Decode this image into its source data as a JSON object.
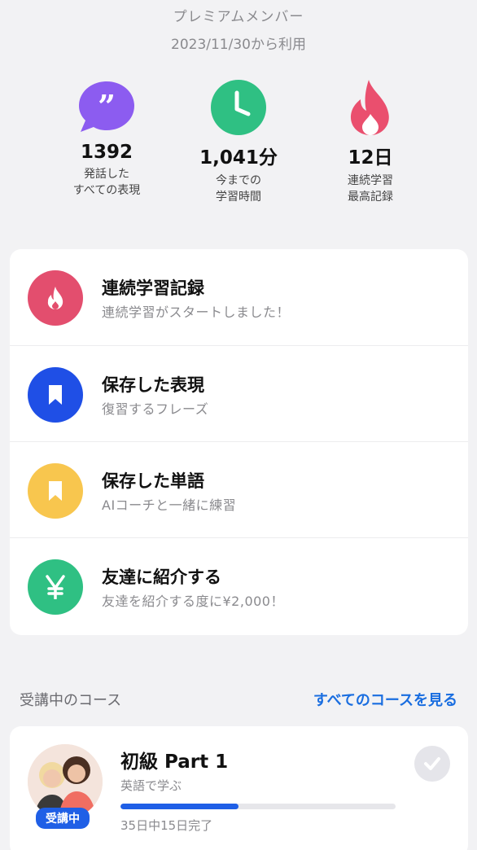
{
  "header": {
    "membership": "プレミアムメンバー",
    "since": "2023/11/30から利用"
  },
  "stats": [
    {
      "value": "1392",
      "label": "発話した\nすべての表現",
      "icon": "speech-bubble-icon",
      "color": "#8c5cf0"
    },
    {
      "value": "1,041分",
      "label": "今までの\n学習時間",
      "icon": "clock-icon",
      "color": "#2fc083"
    },
    {
      "value": "12日",
      "label": "連続学習\n最高記録",
      "icon": "flame-icon",
      "color": "#ea4f6e"
    }
  ],
  "menu": [
    {
      "title": "連続学習記録",
      "subtitle": "連続学習がスタートしました！",
      "icon": "flame-icon",
      "color": "#e34e6e"
    },
    {
      "title": "保存した表現",
      "subtitle": "復習するフレーズ",
      "icon": "bookmark-icon",
      "color": "#1f4fe6"
    },
    {
      "title": "保存した単語",
      "subtitle": "AIコーチと一緒に練習",
      "icon": "bookmark-icon",
      "color": "#f8c64e"
    },
    {
      "title": "友達に紹介する",
      "subtitle": "友達を紹介する度に¥2,000！",
      "icon": "yen-icon",
      "color": "#2fc083"
    }
  ],
  "courses_section": {
    "title": "受講中のコース",
    "see_all": "すべてのコースを見る"
  },
  "course": {
    "title": "初級 Part 1",
    "subtitle": "英語で学ぶ",
    "badge": "受講中",
    "progress_text": "35日中15日完了",
    "progress_fraction": 0.43,
    "accent": "#1f5fe6"
  }
}
